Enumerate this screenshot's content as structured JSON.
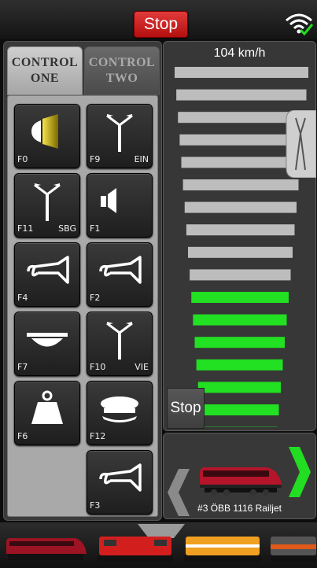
{
  "topbar": {
    "stop_label": "Stop",
    "wifi_icon": "wifi-connected-icon"
  },
  "tabs": [
    {
      "line1": "CONTROL",
      "line2": "ONE",
      "active": true
    },
    {
      "line1": "CONTROL",
      "line2": "TWO",
      "active": false
    }
  ],
  "functions": [
    {
      "label": "F0",
      "sub": "",
      "icon": "headlight-icon"
    },
    {
      "label": "F9",
      "sub": "EIN",
      "icon": "pantograph-icon"
    },
    {
      "label": "F11",
      "sub": "SBG",
      "icon": "pantograph-icon"
    },
    {
      "label": "F1",
      "sub": "",
      "icon": "speaker-icon"
    },
    {
      "label": "F4",
      "sub": "",
      "icon": "horn-icon"
    },
    {
      "label": "F2",
      "sub": "",
      "icon": "horn-icon"
    },
    {
      "label": "F7",
      "sub": "",
      "icon": "cab-light-icon"
    },
    {
      "label": "F10",
      "sub": "VIE",
      "icon": "pantograph-icon"
    },
    {
      "label": "F6",
      "sub": "",
      "icon": "weight-icon"
    },
    {
      "label": "F12",
      "sub": "",
      "icon": "conductor-cap-icon"
    },
    {
      "label": "F3",
      "sub": "",
      "icon": "horn-icon"
    }
  ],
  "throttle": {
    "speed_text": "104 km/h",
    "stop_label": "Stop",
    "level_fraction": 0.41,
    "active_color": "#22e022",
    "inactive_color": "#bdbdbd"
  },
  "loco": {
    "name": "#3 ÖBB 1116 Railjet",
    "next_arrow_color": "#22dd22"
  },
  "colors": {
    "stop_red": "#d32121",
    "panel": "#3a3a3a"
  }
}
